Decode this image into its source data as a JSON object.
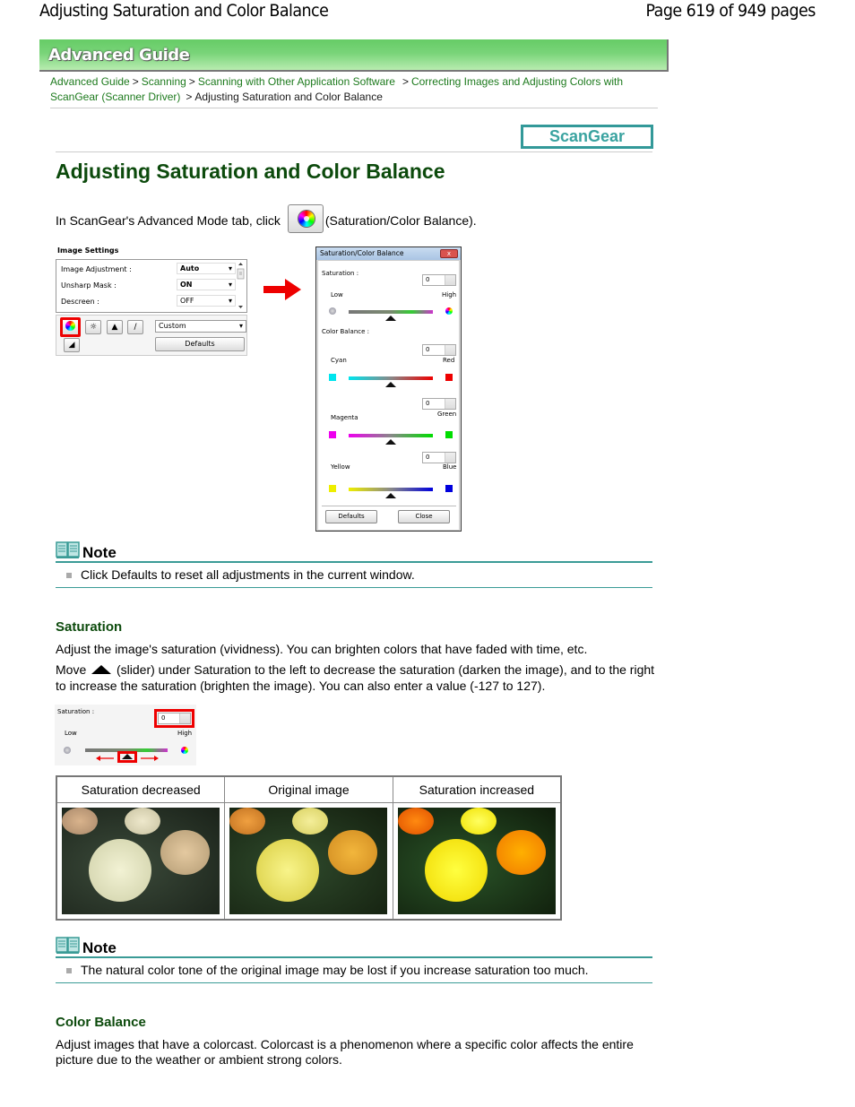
{
  "header": {
    "doc_title": "Adjusting Saturation and Color Balance",
    "page_info": "Page 619 of 949 pages"
  },
  "banner": {
    "title": "Advanced Guide"
  },
  "breadcrumb": {
    "items": [
      {
        "label": "Advanced Guide",
        "link": true
      },
      {
        "label": "Scanning",
        "link": true
      },
      {
        "label": "Scanning with Other Application Software",
        "link": true
      },
      {
        "label": "Correcting Images and Adjusting Colors with ScanGear (Scanner Driver)",
        "link": true
      },
      {
        "label": "Adjusting Saturation and Color Balance",
        "link": false
      }
    ],
    "separator": ">"
  },
  "product_logo": "ScanGear",
  "page_title": "Adjusting Saturation and Color Balance",
  "intro": {
    "before": "In ScanGear's Advanced Mode tab, click",
    "after": "(Saturation/Color Balance)."
  },
  "image_settings": {
    "title": "Image Settings",
    "rows": [
      {
        "label": "Image Adjustment :",
        "value": "Auto"
      },
      {
        "label": "Unsharp Mask :",
        "value": "ON"
      },
      {
        "label": "Descreen :",
        "value": "OFF"
      }
    ],
    "preset": "Custom",
    "defaults_label": "Defaults"
  },
  "dialog": {
    "title": "Saturation/Color Balance",
    "close_glyph": "x",
    "saturation_label": "Saturation :",
    "saturation_value": "0",
    "low_label": "Low",
    "high_label": "High",
    "color_balance_label": "Color Balance :",
    "channels": [
      {
        "left": "Cyan",
        "right": "Red",
        "value": "0",
        "left_color": "#00e5ee",
        "right_color": "#ee0000"
      },
      {
        "left": "Magenta",
        "right": "Green",
        "value": "0",
        "left_color": "#ee00ee",
        "right_color": "#00dd00"
      },
      {
        "left": "Yellow",
        "right": "Blue",
        "value": "0",
        "left_color": "#eeee00",
        "right_color": "#0000dd"
      }
    ],
    "defaults_label": "Defaults",
    "close_label": "Close"
  },
  "notes": [
    {
      "title": "Note",
      "text": "Click Defaults to reset all adjustments in the current window."
    },
    {
      "title": "Note",
      "text": "The natural color tone of the original image may be lost if you increase saturation too much."
    }
  ],
  "saturation_section": {
    "heading": "Saturation",
    "para1": "Adjust the image's saturation (vividness). You can brighten colors that have faded with time, etc.",
    "para2_before": "Move",
    "para2_after": "(slider) under Saturation to the left to decrease the saturation (darken the image), and to the right to increase the saturation (brighten the image). You can also enter a value (-127 to 127).",
    "crop": {
      "label": "Saturation :",
      "value": "0",
      "low": "Low",
      "high": "High"
    },
    "table_headers": [
      "Saturation decreased",
      "Original image",
      "Saturation increased"
    ]
  },
  "color_balance_section": {
    "heading": "Color Balance",
    "para": "Adjust images that have a colorcast. Colorcast is a phenomenon where a specific color affects the entire picture due to the weather or ambient strong colors."
  },
  "colors": {
    "heading_green": "#0c4a0c",
    "link_green": "#1d7a1d",
    "teal_rule": "#3a9b96",
    "highlight_red": "#ee0000"
  }
}
